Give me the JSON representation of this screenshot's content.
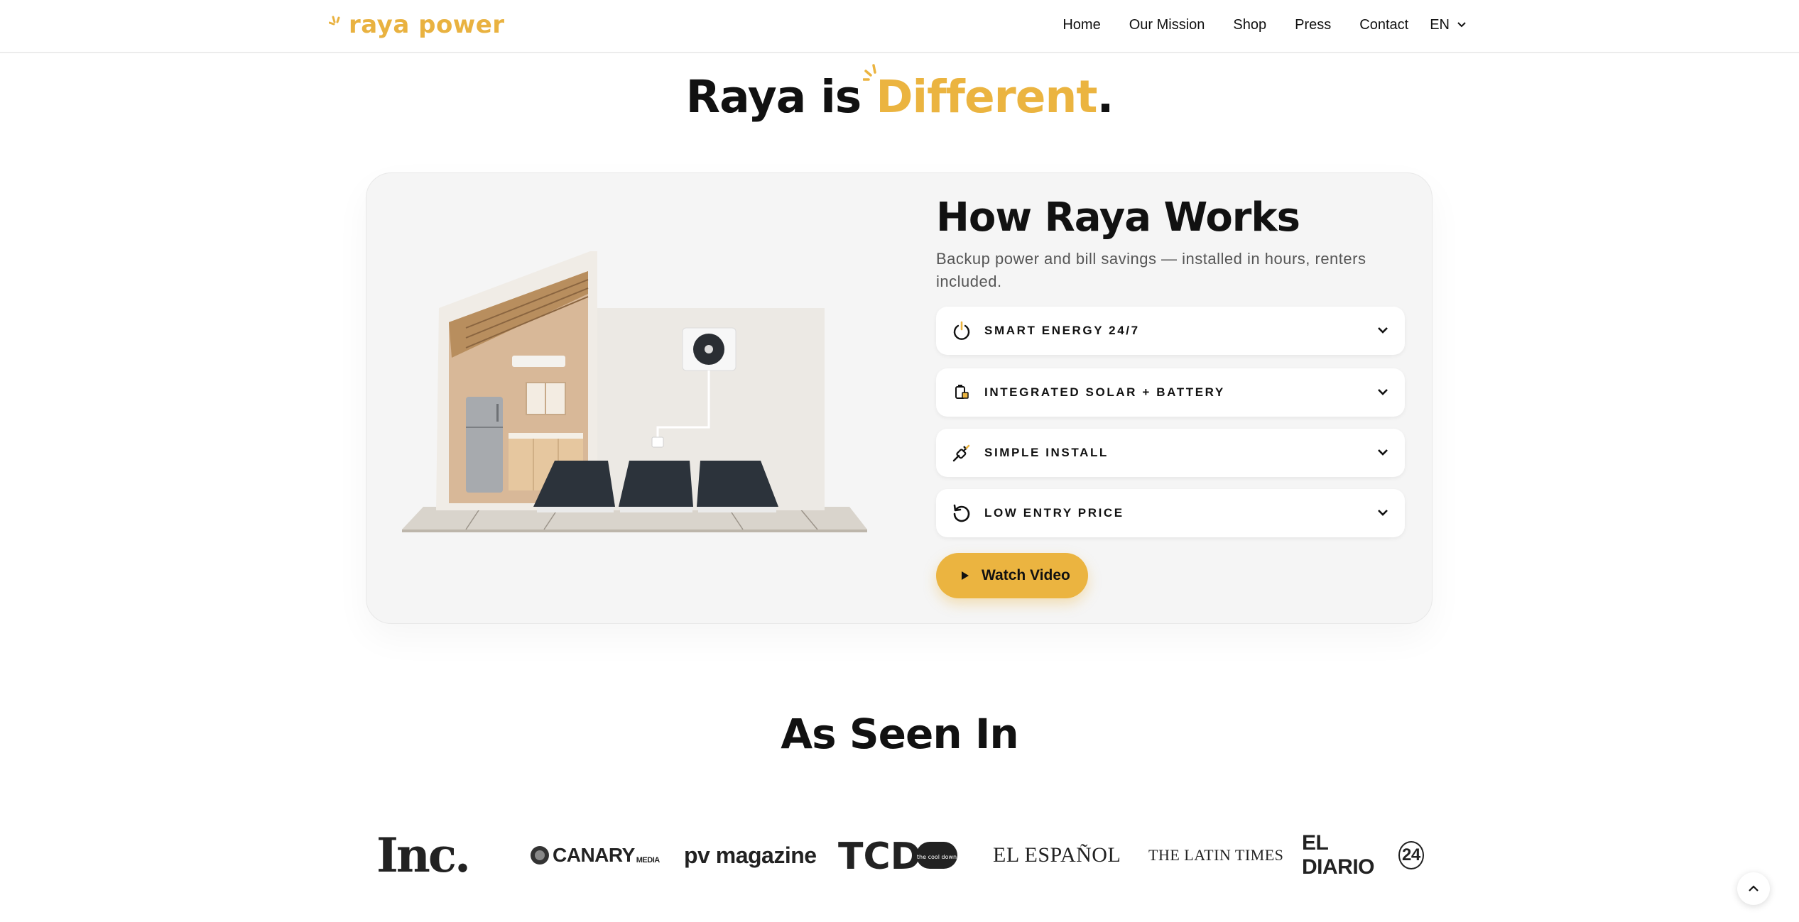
{
  "nav": {
    "logo_text": "raya power",
    "links": [
      "Home",
      "Our Mission",
      "Shop",
      "Press",
      "Contact"
    ],
    "language": "EN"
  },
  "hero": {
    "title_prefix": "Raya is ",
    "title_accent": "Different",
    "title_suffix": "."
  },
  "how_it_works": {
    "title": "How Raya Works",
    "subtitle": "Backup power and bill savings — installed in hours, renters included.",
    "features": [
      {
        "label": "SMART ENERGY 24/7",
        "icon": "power-icon"
      },
      {
        "label": "INTEGRATED SOLAR + BATTERY",
        "icon": "battery-icon"
      },
      {
        "label": "SIMPLE INSTALL",
        "icon": "plug-icon"
      },
      {
        "label": "LOW ENTRY PRICE",
        "icon": "refresh-icon"
      }
    ],
    "cta_label": "Watch Video"
  },
  "press": {
    "title": "As Seen In",
    "logos": [
      "Inc.",
      "CANARY",
      "MEDIA",
      "pv magazine",
      "TCD",
      "the cool down",
      "EL ESPAÑOL",
      "THE LATIN TIMES",
      "EL DIARIO",
      "24"
    ]
  },
  "colors": {
    "accent": "#ebb440",
    "text": "#111111",
    "card_bg": "#f5f5f5"
  }
}
